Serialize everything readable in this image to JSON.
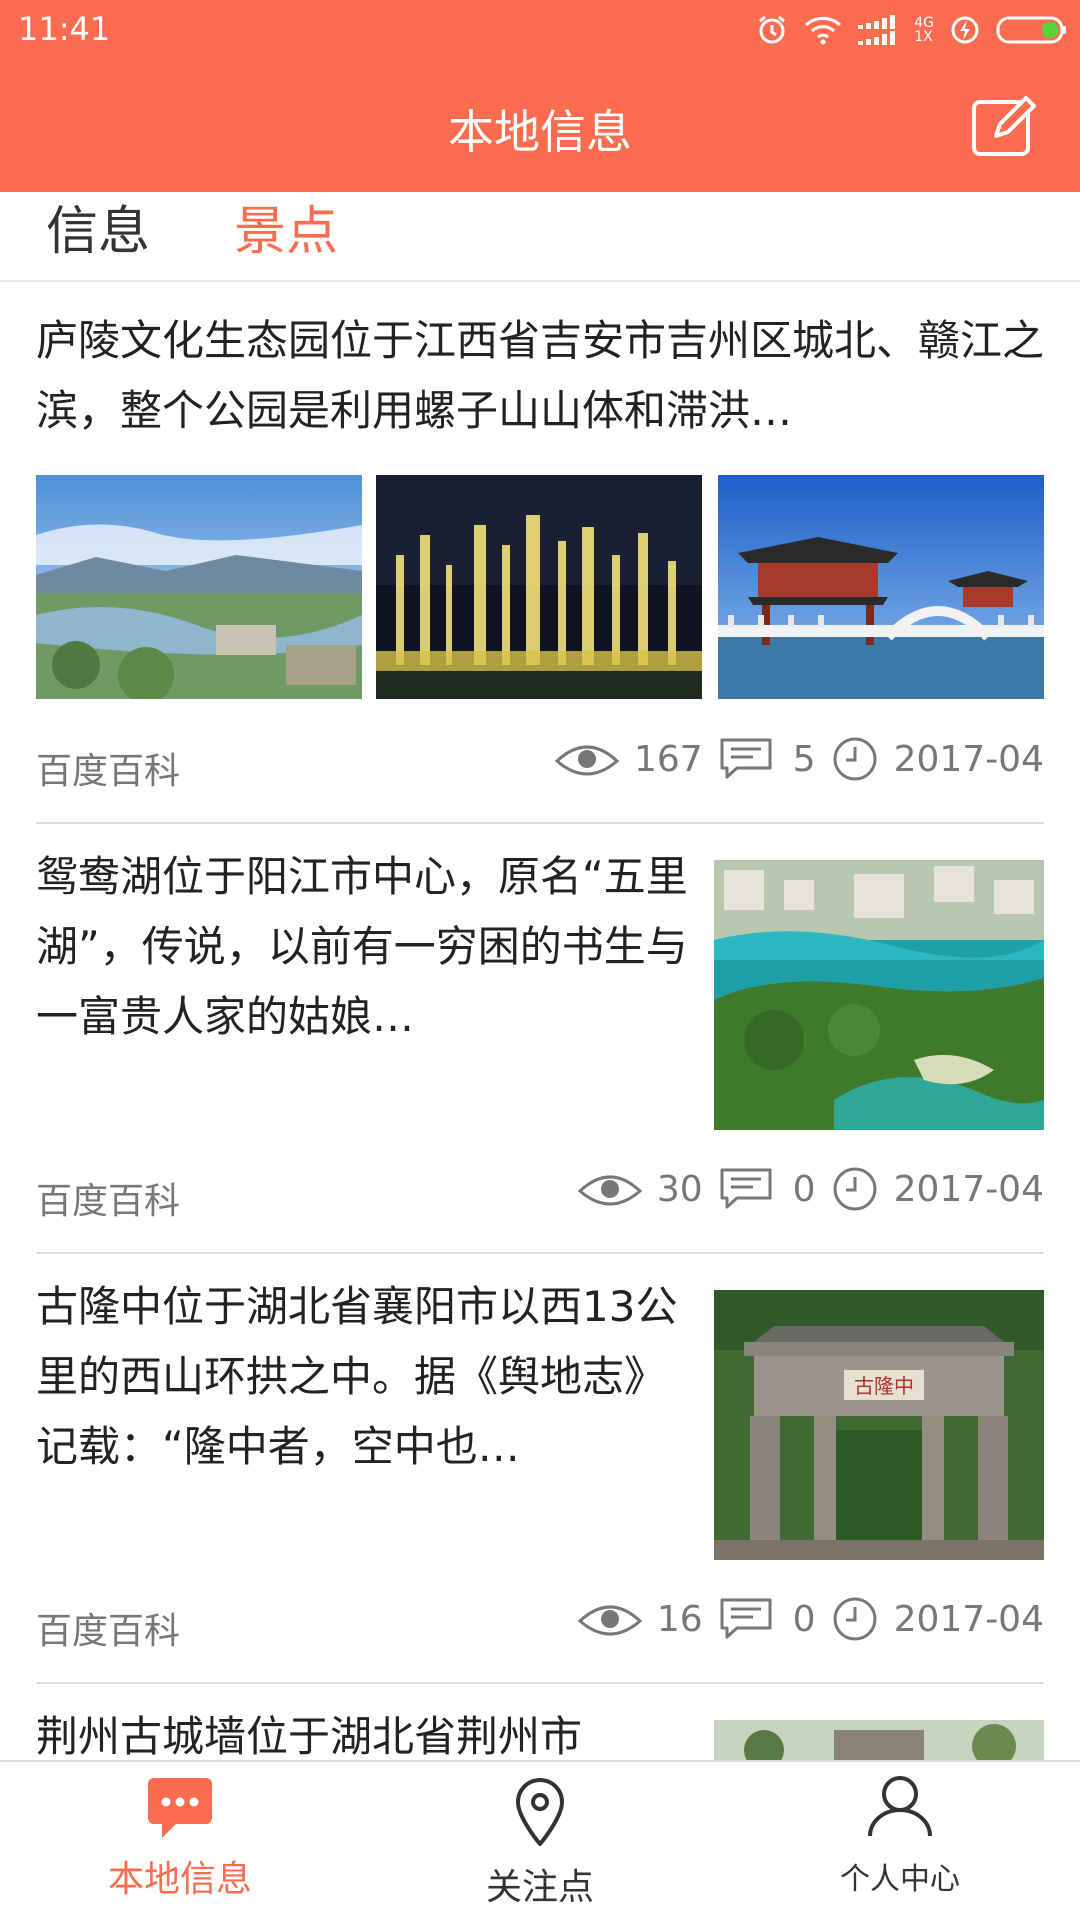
{
  "status_bar": {
    "time": "11:41",
    "network": "4G",
    "network_sub": "1X"
  },
  "header": {
    "title": "本地信息",
    "edit_icon": "edit-icon"
  },
  "tabs": [
    {
      "label": "信息",
      "active": false
    },
    {
      "label": "景点",
      "active": true
    }
  ],
  "feed": [
    {
      "title": "庐陵文化生态园位于江西省吉安市吉州区城北、赣江之滨，整个公园是利用螺子山山体和滞洪…",
      "source": "百度百科",
      "views": "167",
      "comments": "5",
      "date": "2017-04",
      "layout": "three-images"
    },
    {
      "title": "鸳鸯湖位于阳江市中心，原名“五里湖”，传说，以前有一穷困的书生与一富贵人家的姑娘…",
      "source": "百度百科",
      "views": "30",
      "comments": "0",
      "date": "2017-04",
      "layout": "right-image"
    },
    {
      "title": "古隆中位于湖北省襄阳市以西13公里的西山环拱之中。据《舆地志》记载：“隆中者，空中也…",
      "source": "百度百科",
      "views": "16",
      "comments": "0",
      "date": "2017-04",
      "layout": "right-image",
      "image_sign_text": "古隆中"
    },
    {
      "title": "荆州古城墙位于湖北省荆州市",
      "layout": "right-image"
    }
  ],
  "bottom_nav": [
    {
      "label": "本地信息",
      "icon": "chat-bubble-icon",
      "active": true
    },
    {
      "label": "关注点",
      "icon": "location-pin-icon",
      "active": false
    },
    {
      "label": "个人中心",
      "icon": "person-icon",
      "active": false
    }
  ],
  "colors": {
    "accent": "#f96c50",
    "text": "#222222",
    "secondary_text": "#777777",
    "divider": "#dcdcdc"
  }
}
